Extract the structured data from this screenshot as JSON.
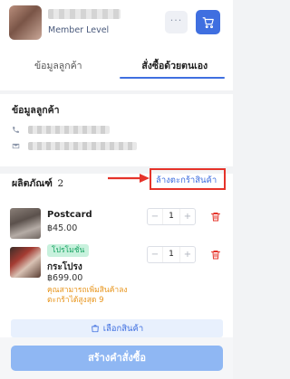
{
  "header": {
    "member_level": "Member Level",
    "more_label": "···"
  },
  "tabs": [
    {
      "label": "ข้อมูลลูกค้า",
      "active": false
    },
    {
      "label": "สั่งซื้อด้วยตนเอง",
      "active": true
    }
  ],
  "customer": {
    "title": "ข้อมูลลูกค้า"
  },
  "products": {
    "title": "ผลิตภัณฑ์",
    "count": "2",
    "clear_cart": "ล้างตะกร้าสินค้า",
    "items": [
      {
        "name": "Postcard",
        "price": "฿45.00",
        "quantity": "1",
        "badge": "",
        "note": ""
      },
      {
        "name": "กระโปรง",
        "price": "฿699.00",
        "quantity": "1",
        "badge": "โปรโมชั่น",
        "note": "คุณสามารถเพิ่มสินค้าลงตะกร้าได้สูงสุด 9"
      }
    ],
    "select_products": "เลือกสินค้า"
  },
  "footer": {
    "create_order": "สร้างคำสั่งซื้อ"
  },
  "colors": {
    "primary": "#3f6fe0",
    "highlight": "#e5332a",
    "promo": "#19a463",
    "warning": "#e8941a"
  }
}
